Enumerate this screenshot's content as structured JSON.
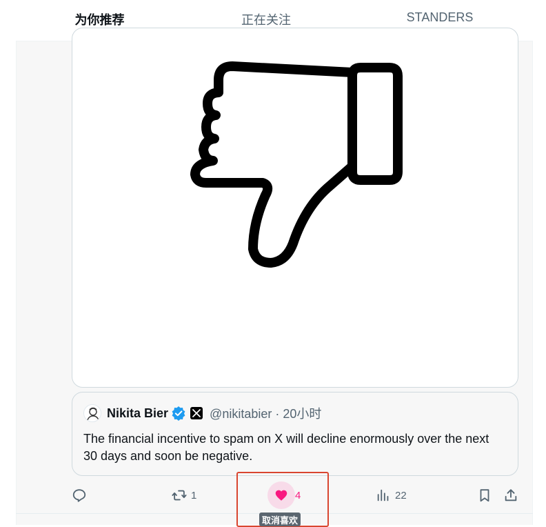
{
  "tabs": [
    {
      "label": "为你推荐",
      "active": true
    },
    {
      "label": "正在关注",
      "active": false
    },
    {
      "label": "STANDERS",
      "active": false
    }
  ],
  "media": {
    "icon": "thumbs-down-icon"
  },
  "quote": {
    "name": "Nikita Bier",
    "handle_time": "@nikitabier · 20小时",
    "text": "The financial incentive to spam on X will decline enormously over the next 30 days and soon be negative."
  },
  "actions": {
    "reply_count": "",
    "retweet_count": "1",
    "like_count": "4",
    "views_count": "22"
  },
  "tooltip": {
    "label": "取消喜欢"
  },
  "colors": {
    "accent": "#1d9bf0",
    "like": "#f91880",
    "highlight_border": "#d9452f"
  }
}
